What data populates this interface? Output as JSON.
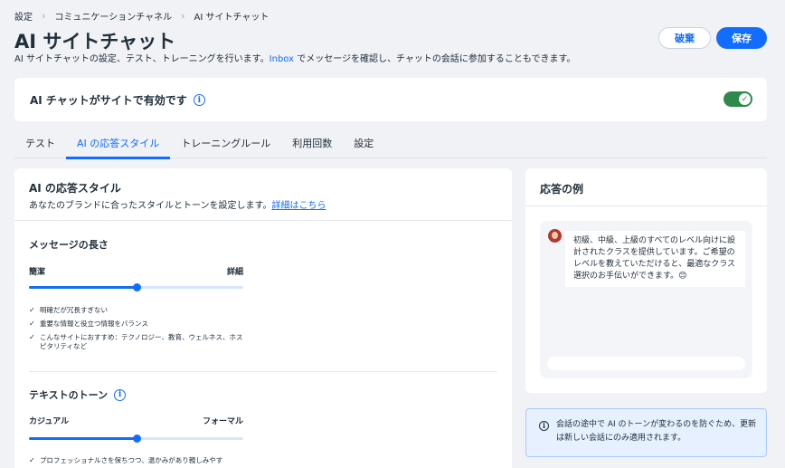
{
  "breadcrumb": [
    "設定",
    "コミュニケーションチャネル",
    "AI サイトチャット"
  ],
  "header": {
    "title": "AI サイトチャット",
    "subtitle_before": "AI サイトチャットの設定、テスト、トレーニングを行います。",
    "subtitle_link": "Inbox",
    "subtitle_after": " でメッセージを確認し、チャットの会話に参加することもできます。",
    "discard_label": "破棄",
    "save_label": "保存"
  },
  "enable": {
    "label": "AI チャットがサイトで有効です",
    "info": "i",
    "toggle_on": true,
    "check": "✓"
  },
  "tabs": [
    "テスト",
    "AI の応答スタイル",
    "トレーニングルール",
    "利用回数",
    "設定"
  ],
  "active_tab": 1,
  "style_card": {
    "title": "AI の応答スタイル",
    "desc": "あなたのブランドに合ったスタイルとトーンを設定します。",
    "link": "詳細はこちら",
    "length": {
      "title": "メッセージの長さ",
      "min_label": "簡潔",
      "max_label": "詳細",
      "value": 0.5,
      "bullets": [
        "明確だが冗長すぎない",
        "重要な情報と役立つ情報をバランス",
        "こんなサイトにおすすめ：テクノロジー、教育、ウェルネス、ホスピタリティなど"
      ]
    },
    "tone": {
      "title": "テキストのトーン",
      "info": "i",
      "min_label": "カジュアル",
      "max_label": "フォーマル",
      "value": 0.5,
      "bullets": [
        "プロフェッショナルさを保ちつつ、温かみがあり親しみやす"
      ]
    },
    "check": "✓"
  },
  "example": {
    "title": "応答の例",
    "message": "初級、中級、上級のすべてのレベル向けに設計されたクラスを提供しています。ご希望のレベルを教えていただけると、最適なクラス選択のお手伝いができます。😊"
  },
  "note": {
    "text": "会話の途中で AI のトーンが変わるのを防ぐため、更新は新しい会話にのみ適用されます。",
    "info": "i"
  },
  "colors": {
    "accent": "#116dff",
    "toggle": "#2e8a4b",
    "background": "#f0f2f5"
  }
}
